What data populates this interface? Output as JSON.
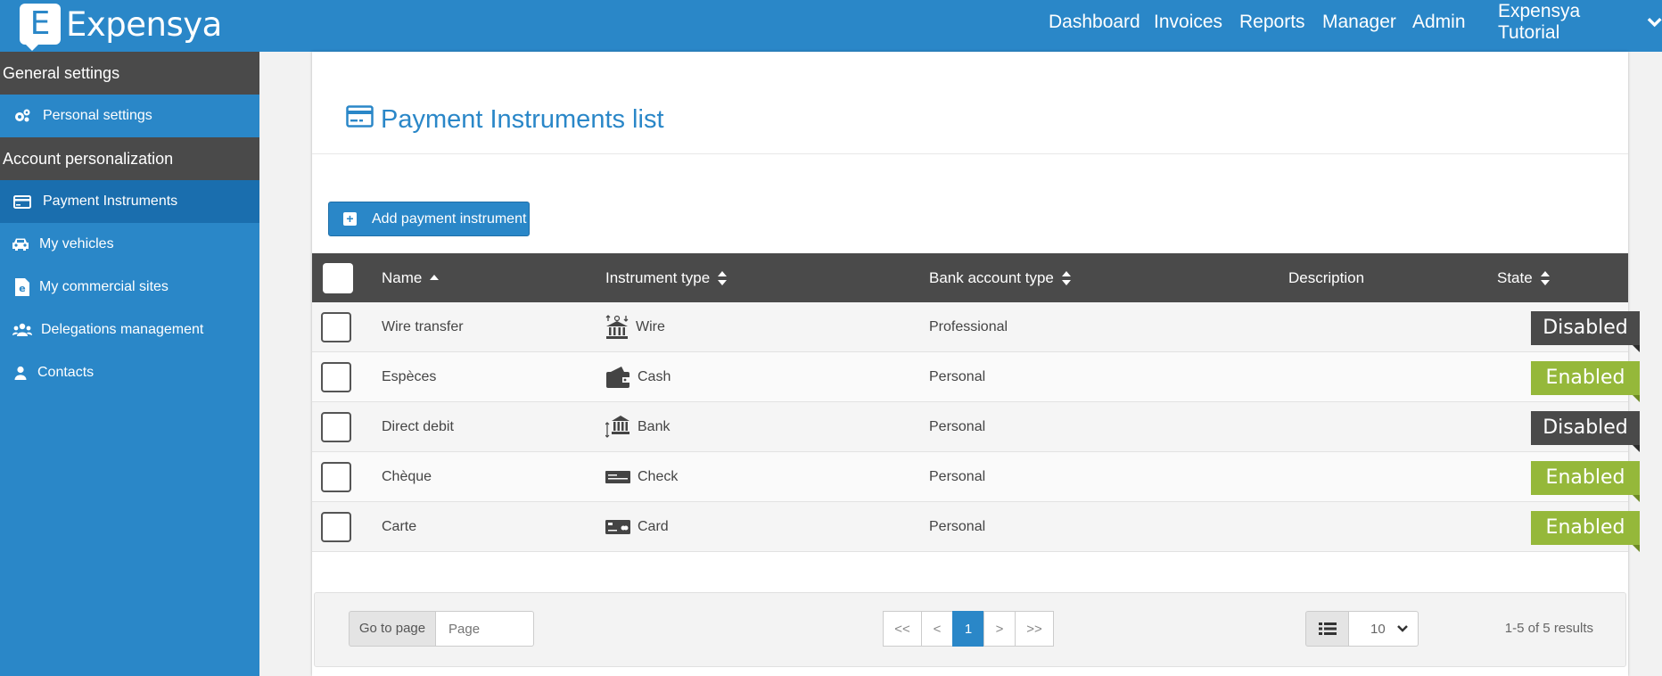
{
  "app": {
    "logo_letter": "E",
    "logo_text": "Expensya"
  },
  "nav": {
    "items": [
      "Dashboard",
      "Invoices",
      "Reports",
      "Manager",
      "Admin"
    ],
    "user": "Expensya Tutorial"
  },
  "sidebar": {
    "section_general": "General settings",
    "item_personal_settings": "Personal settings",
    "section_account": "Account personalization",
    "item_payment_instruments": "Payment Instruments",
    "item_my_vehicles": "My vehicles",
    "item_commercial_sites": "My commercial sites",
    "item_delegations": "Delegations management",
    "item_contacts": "Contacts"
  },
  "page": {
    "title": "Payment Instruments list",
    "add_button": "Add payment instrument"
  },
  "table": {
    "headers": {
      "name": "Name",
      "instrument_type": "Instrument type",
      "bank_account_type": "Bank account type",
      "description": "Description",
      "state": "State"
    },
    "rows": [
      {
        "name": "Wire transfer",
        "type": "Wire",
        "type_icon": "wire-transfer-icon",
        "bank": "Professional",
        "description": "",
        "state": "Disabled"
      },
      {
        "name": "Espèces",
        "type": "Cash",
        "type_icon": "wallet-icon",
        "bank": "Personal",
        "description": "",
        "state": "Enabled"
      },
      {
        "name": "Direct debit",
        "type": "Bank",
        "type_icon": "bank-icon",
        "bank": "Personal",
        "description": "",
        "state": "Disabled"
      },
      {
        "name": "Chèque",
        "type": "Check",
        "type_icon": "check-icon",
        "bank": "Personal",
        "description": "",
        "state": "Enabled"
      },
      {
        "name": "Carte",
        "type": "Card",
        "type_icon": "card-icon",
        "bank": "Personal",
        "description": "",
        "state": "Enabled"
      }
    ]
  },
  "footer": {
    "goto_label": "Go to page",
    "goto_placeholder": "Page",
    "pager": [
      "<<",
      "<",
      "1",
      ">",
      ">>"
    ],
    "current_page": "1",
    "per_page": "10",
    "results": "1-5 of 5 results"
  },
  "colors": {
    "brand": "#2a87c8",
    "dark": "#4a4a4a",
    "enabled": "#95b83a",
    "disabled": "#4a4a4a"
  }
}
